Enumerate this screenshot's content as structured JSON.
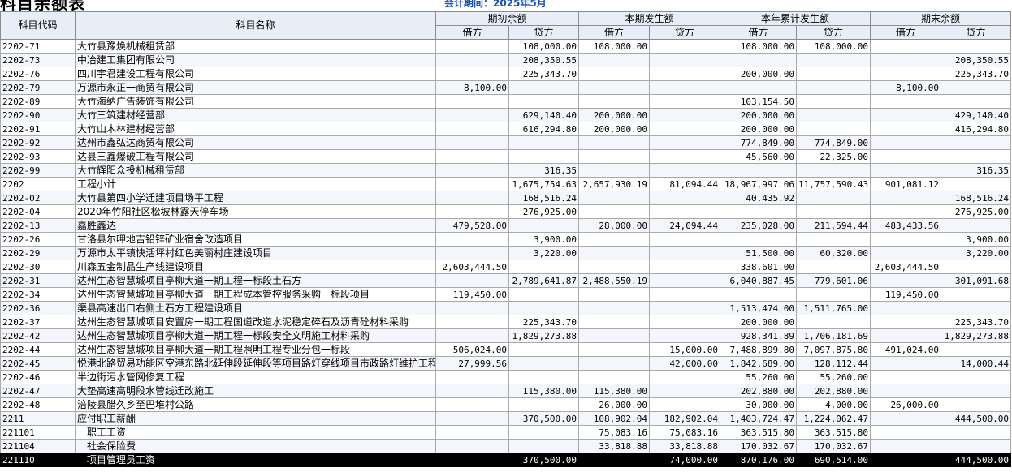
{
  "title": "科目余额表",
  "period_text": "会计期间：2025年5月",
  "headers": {
    "code": "科目代码",
    "name": "科目名称",
    "groups": [
      "期初余额",
      "本期发生额",
      "本年累计发生额",
      "期末余额"
    ],
    "debit": "借方",
    "credit": "贷方"
  },
  "rows": [
    {
      "code": "2202-71",
      "name": "大竹县豫焕机械租赁部",
      "v": [
        "",
        "108,000.00",
        "108,000.00",
        "",
        "108,000.00",
        "108,000.00",
        "",
        ""
      ]
    },
    {
      "code": "2202-73",
      "name": "中冶建工集团有限公司",
      "v": [
        "",
        "208,350.55",
        "",
        "",
        "",
        "",
        "",
        "208,350.55"
      ]
    },
    {
      "code": "2202-76",
      "name": "四川宇君建设工程有限公司",
      "v": [
        "",
        "225,343.70",
        "",
        "",
        "200,000.00",
        "",
        "",
        "225,343.70"
      ]
    },
    {
      "code": "2202-79",
      "name": "万源市永正一商贸有限公司",
      "v": [
        "8,100.00",
        "",
        "",
        "",
        "",
        "",
        "8,100.00",
        ""
      ]
    },
    {
      "code": "2202-89",
      "name": "大竹海纳广告装饰有限公司",
      "v": [
        "",
        "",
        "",
        "",
        "103,154.50",
        "",
        "",
        ""
      ]
    },
    {
      "code": "2202-90",
      "name": "大竹三筑建材经营部",
      "v": [
        "",
        "629,140.40",
        "200,000.00",
        "",
        "200,000.00",
        "",
        "",
        "429,140.40"
      ]
    },
    {
      "code": "2202-91",
      "name": "大竹山木林建材经营部",
      "v": [
        "",
        "616,294.80",
        "200,000.00",
        "",
        "200,000.00",
        "",
        "",
        "416,294.80"
      ]
    },
    {
      "code": "2202-92",
      "name": "达州市鑫弘达商贸有限公司",
      "v": [
        "",
        "",
        "",
        "",
        "774,849.00",
        "774,849.00",
        "",
        ""
      ]
    },
    {
      "code": "2202-93",
      "name": "达县三鑫爆破工程有限公司",
      "v": [
        "",
        "",
        "",
        "",
        "45,560.00",
        "22,325.00",
        "",
        ""
      ]
    },
    {
      "code": "2202-99",
      "name": "大竹辉阳众投机械租赁部",
      "v": [
        "",
        "316.35",
        "",
        "",
        "",
        "",
        "",
        "316.35"
      ]
    },
    {
      "code": "2202",
      "name": "工程小计",
      "v": [
        "",
        "1,675,754.63",
        "2,657,930.19",
        "81,094.44",
        "18,967,997.06",
        "11,757,590.43",
        "901,081.12",
        ""
      ]
    },
    {
      "code": "2202-02",
      "name": "大竹县第四小学迁建项目场平工程",
      "v": [
        "",
        "168,516.24",
        "",
        "",
        "40,435.92",
        "",
        "",
        "168,516.24"
      ]
    },
    {
      "code": "2202-04",
      "name": "2020年竹阳社区松坡林露天停车场",
      "v": [
        "",
        "276,925.00",
        "",
        "",
        "",
        "",
        "",
        "276,925.00"
      ]
    },
    {
      "code": "2202-13",
      "name": "嘉胜鑫达",
      "v": [
        "479,528.00",
        "",
        "28,000.00",
        "24,094.44",
        "235,028.00",
        "211,594.44",
        "483,433.56",
        ""
      ]
    },
    {
      "code": "2202-26",
      "name": "甘洛县尔呷地吉铅锌矿业宿舍改造项目",
      "v": [
        "",
        "3,900.00",
        "",
        "",
        "",
        "",
        "",
        "3,900.00"
      ]
    },
    {
      "code": "2202-29",
      "name": "万源市太平镇快活坪村红色美丽村庄建设项目",
      "v": [
        "",
        "3,220.00",
        "",
        "",
        "51,500.00",
        "60,320.00",
        "",
        "3,220.00"
      ]
    },
    {
      "code": "2202-30",
      "name": "川森五金制品生产线建设项目",
      "v": [
        "2,603,444.50",
        "",
        "",
        "",
        "338,601.00",
        "",
        "2,603,444.50",
        ""
      ]
    },
    {
      "code": "2202-31",
      "name": "达州生态智慧城项目亭柳大道一期工程一标段土石方",
      "v": [
        "",
        "2,789,641.87",
        "2,488,550.19",
        "",
        "6,040,887.45",
        "779,601.06",
        "",
        "301,091.68"
      ]
    },
    {
      "code": "2202-34",
      "name": "达州生态智慧城项目亭柳大道一期工程成本管控服务采购一标段项目",
      "v": [
        "119,450.00",
        "",
        "",
        "",
        "",
        "",
        "119,450.00",
        ""
      ]
    },
    {
      "code": "2202-36",
      "name": "渠县高速出口右侧土石方工程建设项目",
      "v": [
        "",
        "",
        "",
        "",
        "1,513,474.00",
        "1,511,765.00",
        "",
        ""
      ]
    },
    {
      "code": "2202-37",
      "name": "达州生态智慧城项目安置房一期工程国道改道水泥稳定碎石及沥青砼材料采购",
      "v": [
        "",
        "225,343.70",
        "",
        "",
        "200,000.00",
        "",
        "",
        "225,343.70"
      ]
    },
    {
      "code": "2202-42",
      "name": "达州生态智慧城项目亭柳大道一期工程一标段安全文明施工材料采购",
      "v": [
        "",
        "1,829,273.88",
        "",
        "",
        "928,341.89",
        "1,706,181.69",
        "",
        "1,829,273.88"
      ]
    },
    {
      "code": "2202-44",
      "name": "达州生态智慧城项目亭柳大道一期工程照明工程专业分包一标段",
      "v": [
        "506,024.00",
        "",
        "",
        "15,000.00",
        "7,488,899.80",
        "7,097,875.80",
        "491,024.00",
        ""
      ]
    },
    {
      "code": "2202-45",
      "name": "悦港北路贸易功能区空港东路北延伸段延伸段等项目路灯穿线项目市政路灯维护工程",
      "v": [
        "27,999.56",
        "",
        "",
        "42,000.00",
        "1,842,689.00",
        "128,112.44",
        "",
        "14,000.44"
      ]
    },
    {
      "code": "2202-46",
      "name": "半边街污水管网修复工程",
      "v": [
        "",
        "",
        "",
        "",
        "55,260.00",
        "55,260.00",
        "",
        ""
      ]
    },
    {
      "code": "2202-47",
      "name": "大垫高速高明段水管线迁改施工",
      "v": [
        "",
        "115,380.00",
        "115,380.00",
        "",
        "202,880.00",
        "202,880.00",
        "",
        ""
      ]
    },
    {
      "code": "2202-48",
      "name": "涪陵县腊久乡至巴堆村公路",
      "v": [
        "",
        "",
        "26,000.00",
        "",
        "30,000.00",
        "4,000.00",
        "26,000.00",
        ""
      ]
    },
    {
      "code": "2211",
      "name": "应付职工薪酬",
      "v": [
        "",
        "370,500.00",
        "108,902.04",
        "182,902.04",
        "1,403,724.47",
        "1,224,062.47",
        "",
        "444,500.00"
      ]
    },
    {
      "code": "221101",
      "name": "　职工工资",
      "v": [
        "",
        "",
        "75,083.16",
        "75,083.16",
        "363,515.80",
        "363,515.80",
        "",
        ""
      ]
    },
    {
      "code": "221104",
      "name": "　社会保险费",
      "v": [
        "",
        "",
        "33,818.88",
        "33,818.88",
        "170,032.67",
        "170,032.67",
        "",
        ""
      ]
    },
    {
      "code": "221110",
      "name": "　项目管理员工资",
      "v": [
        "",
        "370,500.00",
        "",
        "74,000.00",
        "870,176.00",
        "690,514.00",
        "",
        "444,500.00"
      ],
      "selected": true
    }
  ]
}
